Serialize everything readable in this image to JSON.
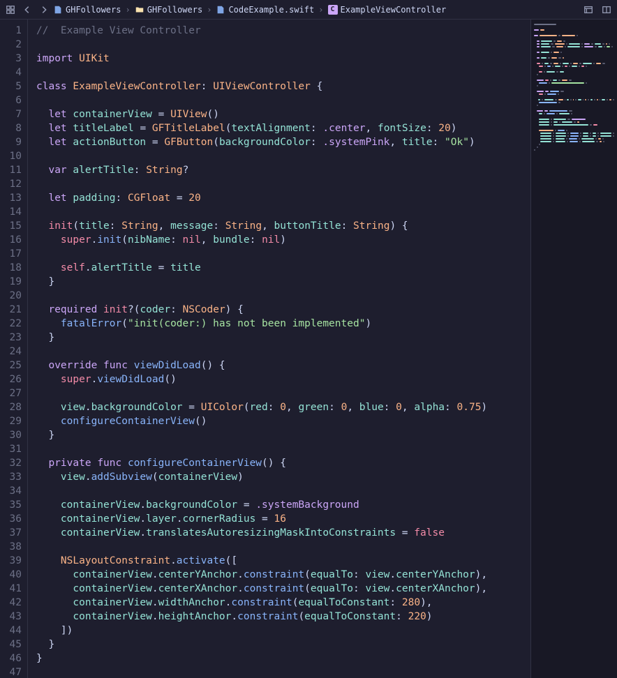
{
  "breadcrumbs": [
    {
      "icon": "file",
      "label": "GHFollowers"
    },
    {
      "icon": "folder",
      "label": "GHFollowers"
    },
    {
      "icon": "file",
      "label": "CodeExample.swift"
    },
    {
      "icon": "class",
      "label": "ExampleViewController"
    }
  ],
  "code": {
    "lines": [
      [
        [
          "comment",
          "//  Example View Controller"
        ]
      ],
      [],
      [
        [
          "keyword",
          "import"
        ],
        [
          "text",
          " "
        ],
        [
          "type",
          "UIKit"
        ]
      ],
      [],
      [
        [
          "keyword",
          "class"
        ],
        [
          "text",
          " "
        ],
        [
          "type",
          "ExampleViewController"
        ],
        [
          "punct",
          ": "
        ],
        [
          "type",
          "UIViewController"
        ],
        [
          "text",
          " "
        ],
        [
          "punct",
          "{"
        ]
      ],
      [],
      [
        [
          "text",
          "  "
        ],
        [
          "keyword",
          "let"
        ],
        [
          "text",
          " "
        ],
        [
          "prop",
          "containerView"
        ],
        [
          "text",
          " = "
        ],
        [
          "type",
          "UIView"
        ],
        [
          "punct",
          "()"
        ]
      ],
      [
        [
          "text",
          "  "
        ],
        [
          "keyword",
          "let"
        ],
        [
          "text",
          " "
        ],
        [
          "prop",
          "titleLabel"
        ],
        [
          "text",
          " = "
        ],
        [
          "type",
          "GFTitleLabel"
        ],
        [
          "punct",
          "("
        ],
        [
          "param",
          "textAlignment"
        ],
        [
          "punct",
          ": "
        ],
        [
          "enum",
          ".center"
        ],
        [
          "punct",
          ", "
        ],
        [
          "param",
          "fontSize"
        ],
        [
          "punct",
          ": "
        ],
        [
          "num",
          "20"
        ],
        [
          "punct",
          ")"
        ]
      ],
      [
        [
          "text",
          "  "
        ],
        [
          "keyword",
          "let"
        ],
        [
          "text",
          " "
        ],
        [
          "prop",
          "actionButton"
        ],
        [
          "text",
          " = "
        ],
        [
          "type",
          "GFButton"
        ],
        [
          "punct",
          "("
        ],
        [
          "param",
          "backgroundColor"
        ],
        [
          "punct",
          ": "
        ],
        [
          "enum",
          ".systemPink"
        ],
        [
          "punct",
          ", "
        ],
        [
          "param",
          "title"
        ],
        [
          "punct",
          ": "
        ],
        [
          "string",
          "\"Ok\""
        ],
        [
          "punct",
          ")"
        ]
      ],
      [],
      [
        [
          "text",
          "  "
        ],
        [
          "keyword",
          "var"
        ],
        [
          "text",
          " "
        ],
        [
          "prop",
          "alertTitle"
        ],
        [
          "punct",
          ": "
        ],
        [
          "type",
          "String"
        ],
        [
          "punct",
          "?"
        ]
      ],
      [],
      [
        [
          "text",
          "  "
        ],
        [
          "keyword",
          "let"
        ],
        [
          "text",
          " "
        ],
        [
          "prop",
          "padding"
        ],
        [
          "punct",
          ": "
        ],
        [
          "type",
          "CGFloat"
        ],
        [
          "text",
          " = "
        ],
        [
          "num",
          "20"
        ]
      ],
      [],
      [
        [
          "text",
          "  "
        ],
        [
          "keyword2",
          "init"
        ],
        [
          "punct",
          "("
        ],
        [
          "param",
          "title"
        ],
        [
          "punct",
          ": "
        ],
        [
          "type",
          "String"
        ],
        [
          "punct",
          ", "
        ],
        [
          "param",
          "message"
        ],
        [
          "punct",
          ": "
        ],
        [
          "type",
          "String"
        ],
        [
          "punct",
          ", "
        ],
        [
          "param",
          "buttonTitle"
        ],
        [
          "punct",
          ": "
        ],
        [
          "type",
          "String"
        ],
        [
          "punct",
          ") {"
        ]
      ],
      [
        [
          "text",
          "    "
        ],
        [
          "self",
          "super"
        ],
        [
          "punct",
          "."
        ],
        [
          "func",
          "init"
        ],
        [
          "punct",
          "("
        ],
        [
          "param",
          "nibName"
        ],
        [
          "punct",
          ": "
        ],
        [
          "const",
          "nil"
        ],
        [
          "punct",
          ", "
        ],
        [
          "param",
          "bundle"
        ],
        [
          "punct",
          ": "
        ],
        [
          "const",
          "nil"
        ],
        [
          "punct",
          ")"
        ]
      ],
      [],
      [
        [
          "text",
          "    "
        ],
        [
          "self",
          "self"
        ],
        [
          "punct",
          "."
        ],
        [
          "prop",
          "alertTitle"
        ],
        [
          "text",
          " = "
        ],
        [
          "prop",
          "title"
        ]
      ],
      [
        [
          "text",
          "  "
        ],
        [
          "punct",
          "}"
        ]
      ],
      [],
      [
        [
          "text",
          "  "
        ],
        [
          "keyword",
          "required"
        ],
        [
          "text",
          " "
        ],
        [
          "keyword2",
          "init"
        ],
        [
          "punct",
          "?("
        ],
        [
          "param",
          "coder"
        ],
        [
          "punct",
          ": "
        ],
        [
          "type",
          "NSCoder"
        ],
        [
          "punct",
          ") {"
        ]
      ],
      [
        [
          "text",
          "    "
        ],
        [
          "func",
          "fatalError"
        ],
        [
          "punct",
          "("
        ],
        [
          "string",
          "\"init(coder:) has not been implemented\""
        ],
        [
          "punct",
          ")"
        ]
      ],
      [
        [
          "text",
          "  "
        ],
        [
          "punct",
          "}"
        ]
      ],
      [],
      [
        [
          "text",
          "  "
        ],
        [
          "keyword",
          "override"
        ],
        [
          "text",
          " "
        ],
        [
          "keyword",
          "func"
        ],
        [
          "text",
          " "
        ],
        [
          "func",
          "viewDidLoad"
        ],
        [
          "punct",
          "() {"
        ]
      ],
      [
        [
          "text",
          "    "
        ],
        [
          "self",
          "super"
        ],
        [
          "punct",
          "."
        ],
        [
          "func",
          "viewDidLoad"
        ],
        [
          "punct",
          "()"
        ]
      ],
      [],
      [
        [
          "text",
          "    "
        ],
        [
          "prop",
          "view"
        ],
        [
          "punct",
          "."
        ],
        [
          "prop",
          "backgroundColor"
        ],
        [
          "text",
          " = "
        ],
        [
          "type",
          "UIColor"
        ],
        [
          "punct",
          "("
        ],
        [
          "param",
          "red"
        ],
        [
          "punct",
          ": "
        ],
        [
          "num",
          "0"
        ],
        [
          "punct",
          ", "
        ],
        [
          "param",
          "green"
        ],
        [
          "punct",
          ": "
        ],
        [
          "num",
          "0"
        ],
        [
          "punct",
          ", "
        ],
        [
          "param",
          "blue"
        ],
        [
          "punct",
          ": "
        ],
        [
          "num",
          "0"
        ],
        [
          "punct",
          ", "
        ],
        [
          "param",
          "alpha"
        ],
        [
          "punct",
          ": "
        ],
        [
          "num",
          "0.75"
        ],
        [
          "punct",
          ")"
        ]
      ],
      [
        [
          "text",
          "    "
        ],
        [
          "func",
          "configureContainerView"
        ],
        [
          "punct",
          "()"
        ]
      ],
      [
        [
          "text",
          "  "
        ],
        [
          "punct",
          "}"
        ]
      ],
      [],
      [
        [
          "text",
          "  "
        ],
        [
          "keyword",
          "private"
        ],
        [
          "text",
          " "
        ],
        [
          "keyword",
          "func"
        ],
        [
          "text",
          " "
        ],
        [
          "func",
          "configureContainerView"
        ],
        [
          "punct",
          "() {"
        ]
      ],
      [
        [
          "text",
          "    "
        ],
        [
          "prop",
          "view"
        ],
        [
          "punct",
          "."
        ],
        [
          "func",
          "addSubview"
        ],
        [
          "punct",
          "("
        ],
        [
          "prop",
          "containerView"
        ],
        [
          "punct",
          ")"
        ]
      ],
      [],
      [
        [
          "text",
          "    "
        ],
        [
          "prop",
          "containerView"
        ],
        [
          "punct",
          "."
        ],
        [
          "prop",
          "backgroundColor"
        ],
        [
          "text",
          " = "
        ],
        [
          "enum",
          ".systemBackground"
        ]
      ],
      [
        [
          "text",
          "    "
        ],
        [
          "prop",
          "containerView"
        ],
        [
          "punct",
          "."
        ],
        [
          "prop",
          "layer"
        ],
        [
          "punct",
          "."
        ],
        [
          "prop",
          "cornerRadius"
        ],
        [
          "text",
          " = "
        ],
        [
          "num",
          "16"
        ]
      ],
      [
        [
          "text",
          "    "
        ],
        [
          "prop",
          "containerView"
        ],
        [
          "punct",
          "."
        ],
        [
          "prop",
          "translatesAutoresizingMaskIntoConstraints"
        ],
        [
          "text",
          " = "
        ],
        [
          "const",
          "false"
        ]
      ],
      [],
      [
        [
          "text",
          "    "
        ],
        [
          "type",
          "NSLayoutConstraint"
        ],
        [
          "punct",
          "."
        ],
        [
          "func",
          "activate"
        ],
        [
          "punct",
          "(["
        ]
      ],
      [
        [
          "text",
          "      "
        ],
        [
          "prop",
          "containerView"
        ],
        [
          "punct",
          "."
        ],
        [
          "prop",
          "centerYAnchor"
        ],
        [
          "punct",
          "."
        ],
        [
          "func",
          "constraint"
        ],
        [
          "punct",
          "("
        ],
        [
          "param",
          "equalTo"
        ],
        [
          "punct",
          ": "
        ],
        [
          "prop",
          "view"
        ],
        [
          "punct",
          "."
        ],
        [
          "prop",
          "centerYAnchor"
        ],
        [
          "punct",
          "),"
        ]
      ],
      [
        [
          "text",
          "      "
        ],
        [
          "prop",
          "containerView"
        ],
        [
          "punct",
          "."
        ],
        [
          "prop",
          "centerXAnchor"
        ],
        [
          "punct",
          "."
        ],
        [
          "func",
          "constraint"
        ],
        [
          "punct",
          "("
        ],
        [
          "param",
          "equalTo"
        ],
        [
          "punct",
          ": "
        ],
        [
          "prop",
          "view"
        ],
        [
          "punct",
          "."
        ],
        [
          "prop",
          "centerXAnchor"
        ],
        [
          "punct",
          "),"
        ]
      ],
      [
        [
          "text",
          "      "
        ],
        [
          "prop",
          "containerView"
        ],
        [
          "punct",
          "."
        ],
        [
          "prop",
          "widthAnchor"
        ],
        [
          "punct",
          "."
        ],
        [
          "func",
          "constraint"
        ],
        [
          "punct",
          "("
        ],
        [
          "param",
          "equalToConstant"
        ],
        [
          "punct",
          ": "
        ],
        [
          "num",
          "280"
        ],
        [
          "punct",
          "),"
        ]
      ],
      [
        [
          "text",
          "      "
        ],
        [
          "prop",
          "containerView"
        ],
        [
          "punct",
          "."
        ],
        [
          "prop",
          "heightAnchor"
        ],
        [
          "punct",
          "."
        ],
        [
          "func",
          "constraint"
        ],
        [
          "punct",
          "("
        ],
        [
          "param",
          "equalToConstant"
        ],
        [
          "punct",
          ": "
        ],
        [
          "num",
          "220"
        ],
        [
          "punct",
          ")"
        ]
      ],
      [
        [
          "text",
          "    "
        ],
        [
          "punct",
          "])"
        ]
      ],
      [
        [
          "text",
          "  "
        ],
        [
          "punct",
          "}"
        ]
      ],
      [
        [
          "punct",
          "}"
        ]
      ],
      []
    ]
  },
  "minimap": {
    "colors": {
      "comment": "#6c7086",
      "keyword": "#cba6f7",
      "keyword2": "#f38ba8",
      "type": "#fab387",
      "func": "#89b4fa",
      "prop": "#94e2d5",
      "string": "#a6e3a1",
      "num": "#fab387",
      "param": "#94e2d5",
      "punct": "#585b70",
      "enum": "#cba6f7",
      "self": "#f38ba8",
      "const": "#f38ba8",
      "text": "#585b70"
    }
  }
}
